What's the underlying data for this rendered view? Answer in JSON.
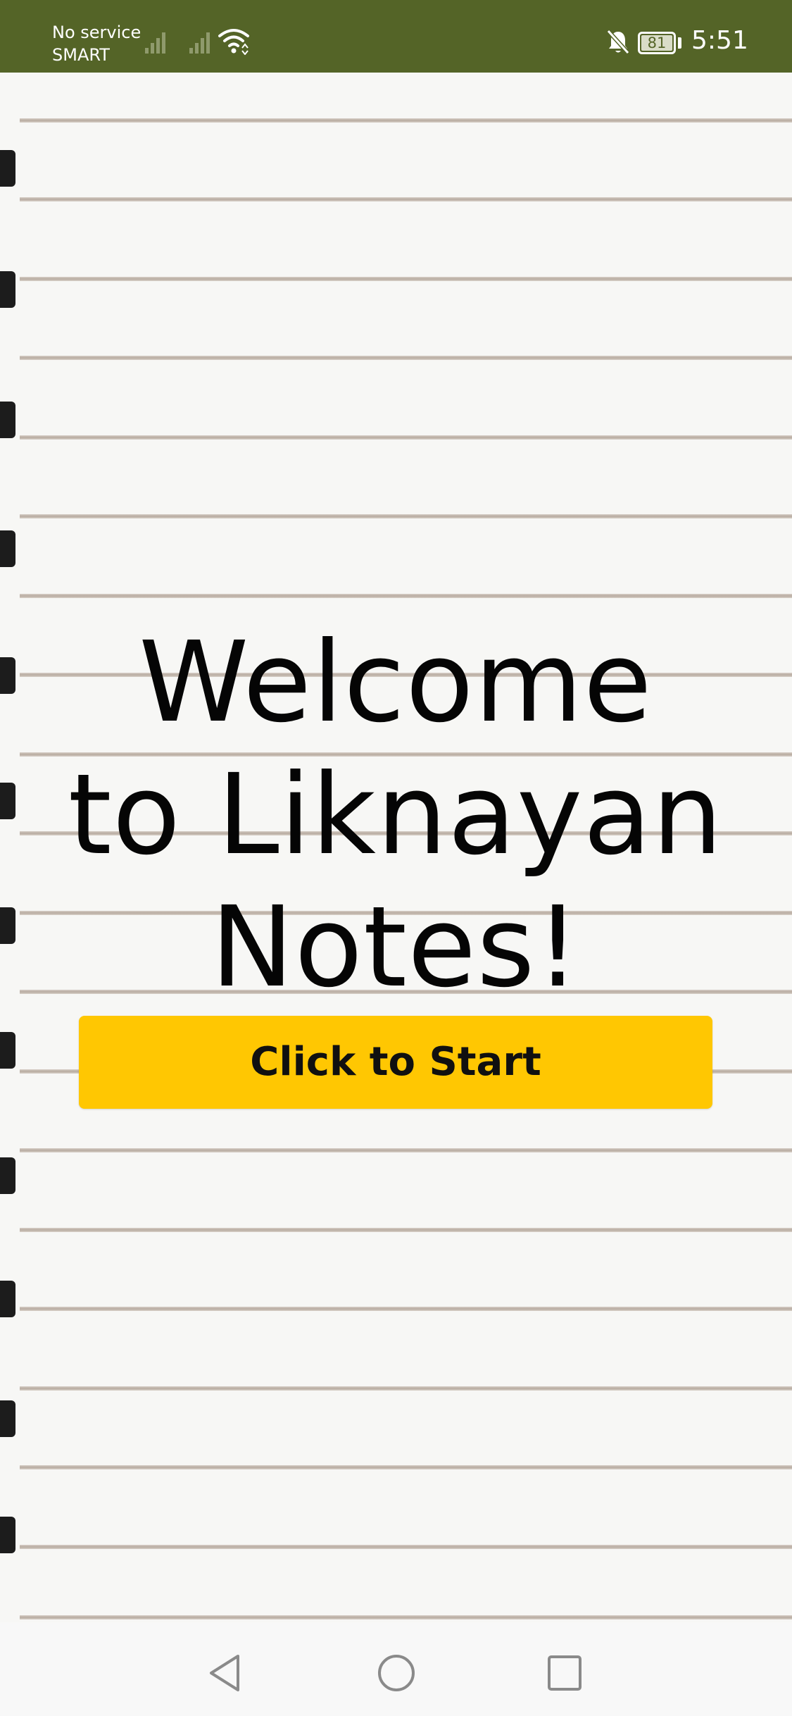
{
  "status_bar": {
    "carrier_line_1": "No service",
    "carrier_line_2": "SMART",
    "battery_level": "81",
    "time": "5:51",
    "background_color": "#546427",
    "icons": [
      "signal-icon",
      "signal-icon",
      "wifi-icon",
      "bell-off-icon",
      "battery-icon"
    ]
  },
  "main": {
    "welcome_line_1": "Welcome",
    "welcome_line_2": "to Liknayan",
    "welcome_line_3": "Notes!",
    "start_button_label": "Click to Start",
    "start_button_color": "#ffc702"
  },
  "nav_bar": {
    "icons": [
      "back-icon",
      "home-icon",
      "recents-icon"
    ]
  }
}
